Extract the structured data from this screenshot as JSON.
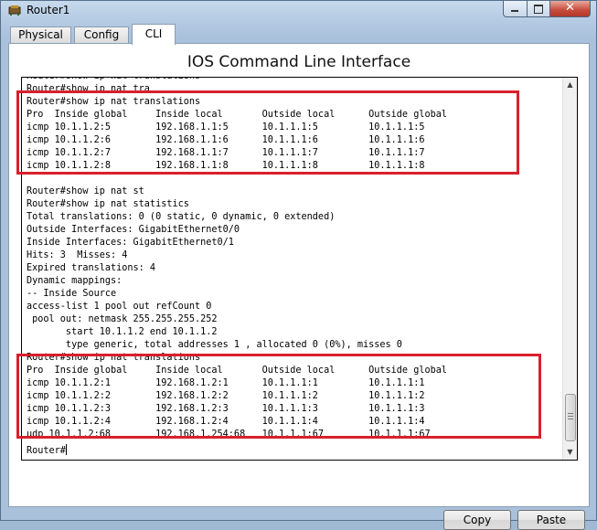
{
  "window": {
    "title": "Router1",
    "close_glyph": "✕"
  },
  "tabs": [
    {
      "label": "Physical"
    },
    {
      "label": "Config"
    },
    {
      "label": "CLI"
    }
  ],
  "panel": {
    "title": "IOS Command Line Interface"
  },
  "terminal": {
    "lines": [
      "Router#show ip nat translations",
      "Router#show ip nat tra",
      "Router#show ip nat translations",
      "Pro  Inside global     Inside local       Outside local      Outside global",
      "icmp 10.1.1.2:5        192.168.1.1:5      10.1.1.1:5         10.1.1.1:5",
      "icmp 10.1.1.2:6        192.168.1.1:6      10.1.1.1:6         10.1.1.1:6",
      "icmp 10.1.1.2:7        192.168.1.1:7      10.1.1.1:7         10.1.1.1:7",
      "icmp 10.1.1.2:8        192.168.1.1:8      10.1.1.1:8         10.1.1.1:8",
      "",
      "Router#show ip nat st",
      "Router#show ip nat statistics",
      "Total translations: 0 (0 static, 0 dynamic, 0 extended)",
      "Outside Interfaces: GigabitEthernet0/0",
      "Inside Interfaces: GigabitEthernet0/1",
      "Hits: 3  Misses: 4",
      "Expired translations: 4",
      "Dynamic mappings:",
      "-- Inside Source",
      "access-list 1 pool out refCount 0",
      " pool out: netmask 255.255.255.252",
      "       start 10.1.1.2 end 10.1.1.2",
      "       type generic, total addresses 1 , allocated 0 (0%), misses 0",
      "Router#show ip nat translations",
      "Pro  Inside global     Inside local       Outside local      Outside global",
      "icmp 10.1.1.2:1        192.168.1.2:1      10.1.1.1:1         10.1.1.1:1",
      "icmp 10.1.1.2:2        192.168.1.2:2      10.1.1.1:2         10.1.1.1:2",
      "icmp 10.1.1.2:3        192.168.1.2:3      10.1.1.1:3         10.1.1.1:3",
      "icmp 10.1.1.2:4        192.168.1.2:4      10.1.1.1:4         10.1.1.1:4",
      "udp 10.1.1.2:68        192.168.1.254:68   10.1.1.1:67        10.1.1.1:67",
      ""
    ],
    "prompt": "Router#"
  },
  "buttons": {
    "copy": "Copy",
    "paste": "Paste"
  },
  "colors": {
    "highlight": "#d9202c"
  }
}
